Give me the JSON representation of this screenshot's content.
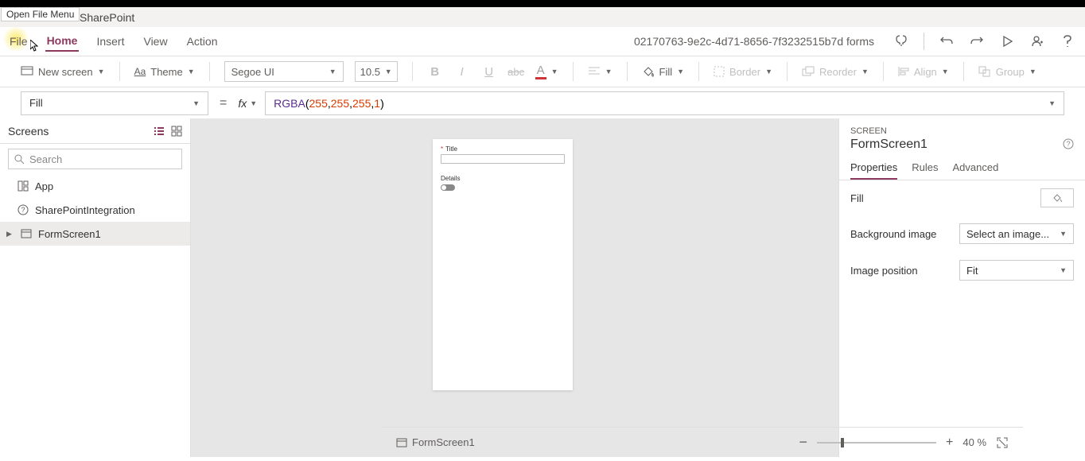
{
  "tooltip": "Open File Menu",
  "brand": "SharePoint",
  "menu": {
    "file": "File",
    "home": "Home",
    "insert": "Insert",
    "view": "View",
    "action": "Action"
  },
  "docName": "02170763-9e2c-4d71-8656-7f3232515b7d forms",
  "ribbon": {
    "newScreen": "New screen",
    "theme": "Theme",
    "font": "Segoe UI",
    "fontSize": "10.5",
    "fill": "Fill",
    "border": "Border",
    "reorder": "Reorder",
    "align": "Align",
    "group": "Group"
  },
  "formula": {
    "property": "Fill",
    "fn": "RGBA",
    "args": [
      "255",
      "255",
      "255",
      "1"
    ]
  },
  "leftPane": {
    "title": "Screens",
    "searchPlaceholder": "Search",
    "items": {
      "app": "App",
      "spi": "SharePointIntegration",
      "form": "FormScreen1"
    }
  },
  "canvasForm": {
    "titleLabel": "Title",
    "detailsLabel": "Details"
  },
  "rightPane": {
    "type": "SCREEN",
    "name": "FormScreen1",
    "tabs": {
      "props": "Properties",
      "rules": "Rules",
      "adv": "Advanced"
    },
    "rows": {
      "fill": "Fill",
      "bgImage": "Background image",
      "bgImageValue": "Select an image...",
      "imgPos": "Image position",
      "imgPosValue": "Fit"
    }
  },
  "status": {
    "crumb": "FormScreen1",
    "zoomVal": "40",
    "zoomPct": "%"
  }
}
